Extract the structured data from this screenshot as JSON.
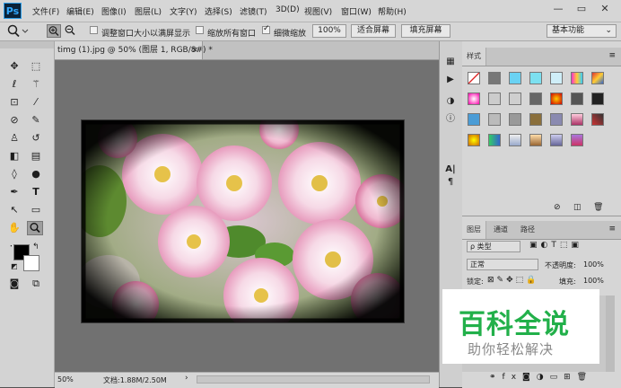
{
  "app": {
    "logo": "Ps"
  },
  "menu": [
    "文件(F)",
    "编辑(E)",
    "图像(I)",
    "图层(L)",
    "文字(Y)",
    "选择(S)",
    "滤镜(T)",
    "3D(D)",
    "视图(V)",
    "窗口(W)",
    "帮助(H)"
  ],
  "window_controls": {
    "minimize": "—",
    "restore": "▭",
    "close": "✕"
  },
  "options": {
    "tool_icon": "zoom-icon",
    "resize_windows_label": "调整窗口大小以满屏显示",
    "resize_windows_checked": false,
    "zoom_all_label": "缩放所有窗口",
    "zoom_all_checked": false,
    "scrubby_label": "细微缩放",
    "scrubby_checked": true,
    "zoom_value": "100%",
    "fit_screen": "适合屏幕",
    "fill_screen": "填充屏幕",
    "workspace": "基本功能"
  },
  "document": {
    "tab_title": "timg (1).jpg @ 50% (图层 1, RGB/8#) *",
    "zoom": "50%",
    "doc_size": "文档:1.88M/2.50M"
  },
  "styles_panel": {
    "tab": "样式"
  },
  "layers_panel": {
    "tabs": [
      "图层",
      "通道",
      "路径"
    ],
    "filter": "ρ 类型",
    "blend_mode": "正常",
    "opacity_label": "不透明度:",
    "opacity_value": "100%",
    "lock_label": "锁定:",
    "fill_label": "填充:",
    "fill_value": "100%"
  },
  "watermark": {
    "title": "百科全说",
    "subtitle": "助你轻松解决"
  },
  "colors": {
    "accent": "#31a8ff",
    "watermark_green": "#22b04a",
    "watermark_gray": "#888888"
  }
}
